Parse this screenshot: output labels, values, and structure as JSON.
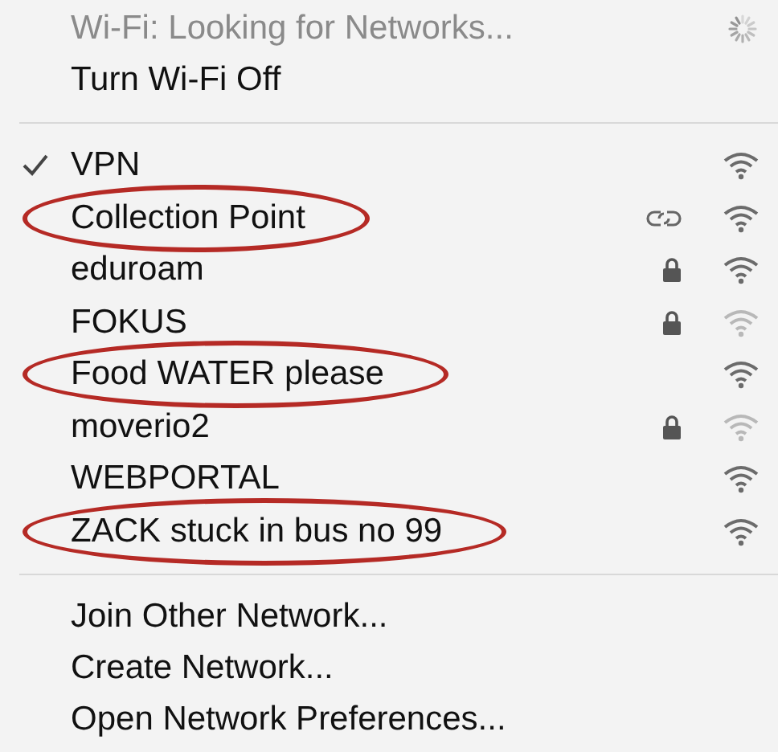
{
  "status": {
    "text": "Wi-Fi: Looking for Networks...",
    "busy": true
  },
  "toggle": {
    "label": "Turn Wi-Fi Off"
  },
  "networks": [
    {
      "name": "VPN",
      "checked": true,
      "secure": false,
      "linked": false,
      "weak": false,
      "circled": false
    },
    {
      "name": "Collection Point",
      "checked": false,
      "secure": false,
      "linked": true,
      "weak": false,
      "circled": true
    },
    {
      "name": "eduroam",
      "checked": false,
      "secure": true,
      "linked": false,
      "weak": false,
      "circled": false
    },
    {
      "name": "FOKUS",
      "checked": false,
      "secure": true,
      "linked": false,
      "weak": true,
      "circled": false
    },
    {
      "name": "Food WATER please",
      "checked": false,
      "secure": false,
      "linked": false,
      "weak": false,
      "circled": true
    },
    {
      "name": "moverio2",
      "checked": false,
      "secure": true,
      "linked": false,
      "weak": true,
      "circled": false
    },
    {
      "name": "WEBPORTAL",
      "checked": false,
      "secure": false,
      "linked": false,
      "weak": false,
      "circled": false
    },
    {
      "name": "ZACK stuck in bus no 99",
      "checked": false,
      "secure": false,
      "linked": false,
      "weak": false,
      "circled": true
    }
  ],
  "actions": [
    "Join Other Network...",
    "Create Network...",
    "Open Network Preferences..."
  ]
}
